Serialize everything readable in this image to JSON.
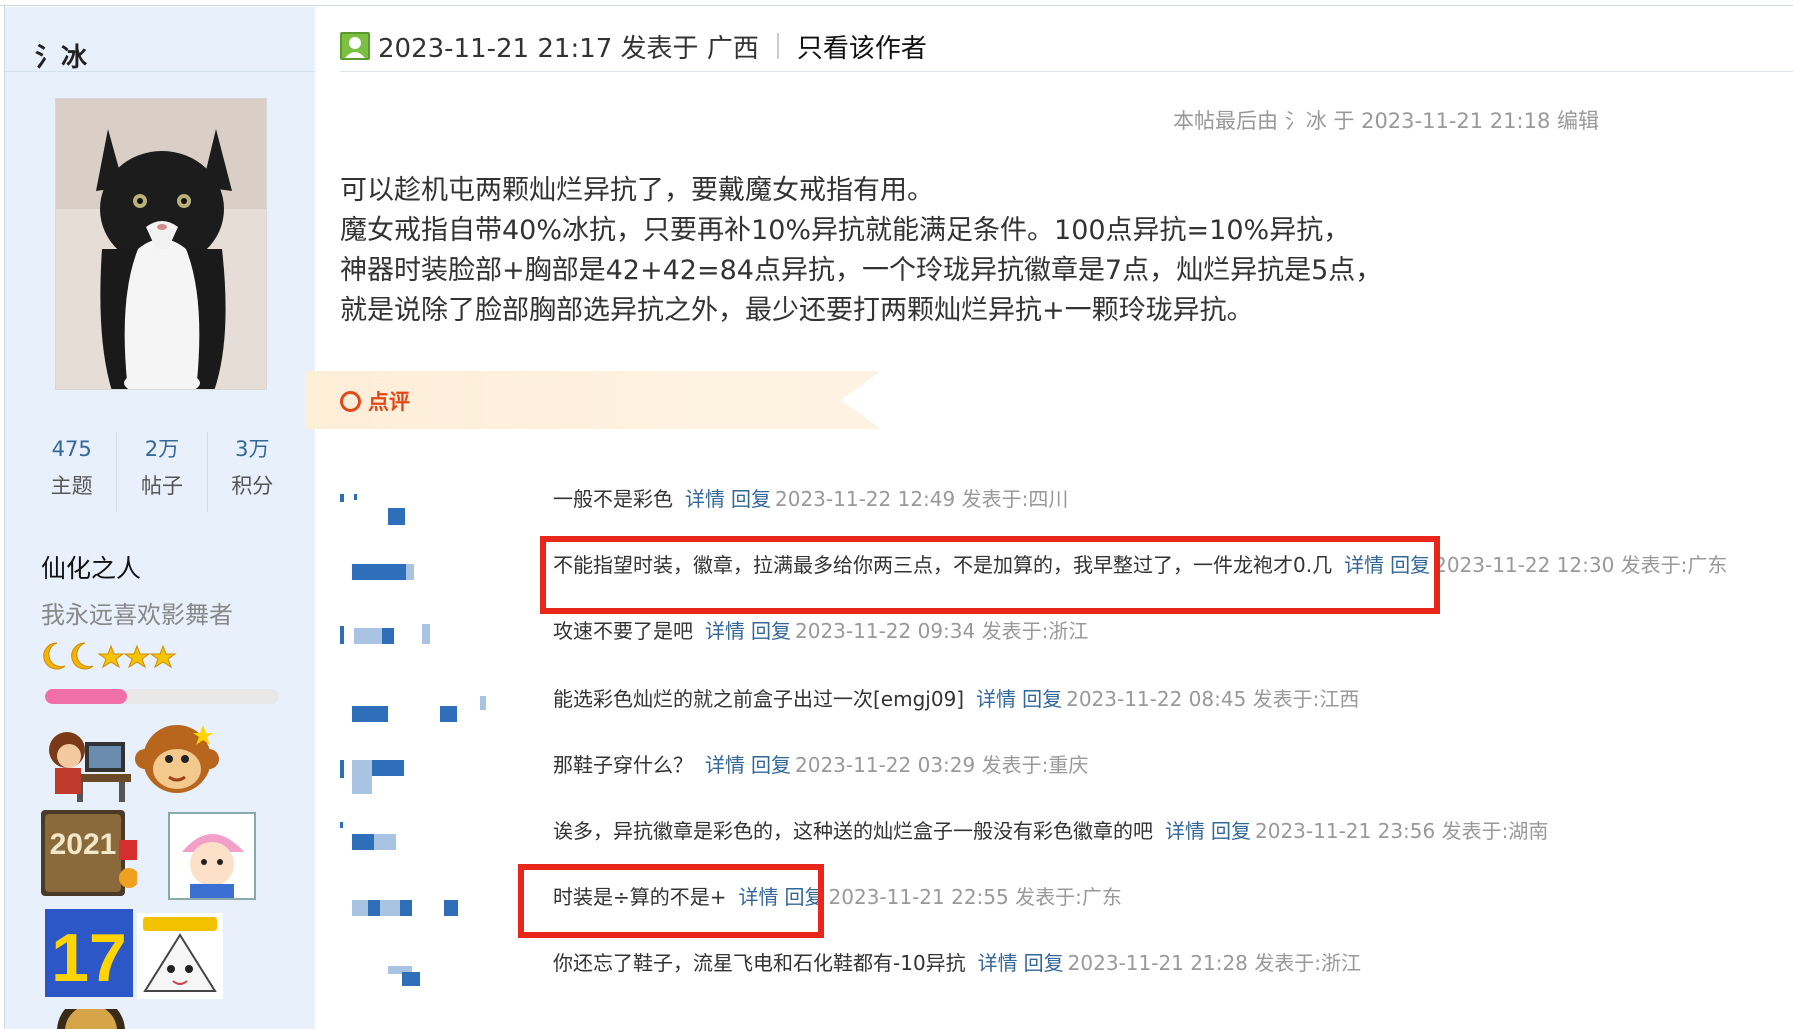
{
  "sidebar": {
    "author": "氵冰",
    "stats": [
      {
        "value": "475",
        "label": "主题"
      },
      {
        "value": "2万",
        "label": "帖子"
      },
      {
        "value": "3万",
        "label": "积分"
      }
    ],
    "group": "仙化之人",
    "signature": "我永远喜欢影舞者",
    "level_progress": 0.35,
    "medals": [
      {
        "name": "computer-kid-medal"
      },
      {
        "name": "monkey-medal"
      },
      {
        "name": "2021-medal",
        "text": "2021"
      },
      {
        "name": "cartoon-girl-medal"
      },
      {
        "name": "17-medal",
        "text": "17"
      },
      {
        "name": "onigiri-medal"
      }
    ]
  },
  "post": {
    "time": "2023-11-21 21:17 发表于 广西",
    "only_author": "只看该作者",
    "edit_note": "本帖最后由 氵冰 于 2023-11-21 21:18 编辑",
    "lines": [
      "可以趁机屯两颗灿烂异抗了，要戴魔女戒指有用。",
      "魔女戒指自带40%冰抗，只要再补10%异抗就能满足条件。100点异抗=10%异抗，",
      "神器时装脸部+胸部是42+42=84点异抗，一个玲珑异抗徽章是7点，灿烂异抗是5点，",
      "就是说除了脸部胸部选异抗之外，最少还要打两颗灿烂异抗+一颗玲珑异抗。"
    ]
  },
  "comments": {
    "title": "点评",
    "items": [
      {
        "text": "一般不是彩色",
        "detail": "详情",
        "reply": "回复",
        "meta": "2023-11-22 12:49 发表于:四川"
      },
      {
        "text": "不能指望时装，徽章，拉满最多给你两三点，不是加算的，我早整过了，一件龙袍才0.几",
        "detail": "详情",
        "reply": "回复",
        "meta": "2023-11-22 12:30 发表于:广东"
      },
      {
        "text": "攻速不要了是吧",
        "detail": "详情",
        "reply": "回复",
        "meta": "2023-11-22 09:34 发表于:浙江"
      },
      {
        "text": "能选彩色灿烂的就之前盒子出过一次[emgj09]",
        "detail": "详情",
        "reply": "回复",
        "meta": "2023-11-22 08:45 发表于:江西"
      },
      {
        "text": "那鞋子穿什么？",
        "detail": "详情",
        "reply": "回复",
        "meta": "2023-11-22 03:29 发表于:重庆"
      },
      {
        "text": "诶多，异抗徽章是彩色的，这种送的灿烂盒子一般没有彩色徽章的吧",
        "detail": "详情",
        "reply": "回复",
        "meta": "2023-11-21 23:56 发表于:湖南"
      },
      {
        "text": "时装是÷算的不是+",
        "detail": "详情",
        "reply": "回复",
        "meta": "2023-11-21 22:55 发表于:广东"
      },
      {
        "text": "你还忘了鞋子，流星飞电和石化鞋都有-10异抗",
        "detail": "详情",
        "reply": "回复",
        "meta": "2023-11-21 21:28 发表于:浙江"
      }
    ]
  },
  "colors": {
    "sidebar_bg": "#e8f1fb",
    "link": "#336699",
    "highlight": "#e8261a",
    "comment_title": "#e04a1a"
  }
}
